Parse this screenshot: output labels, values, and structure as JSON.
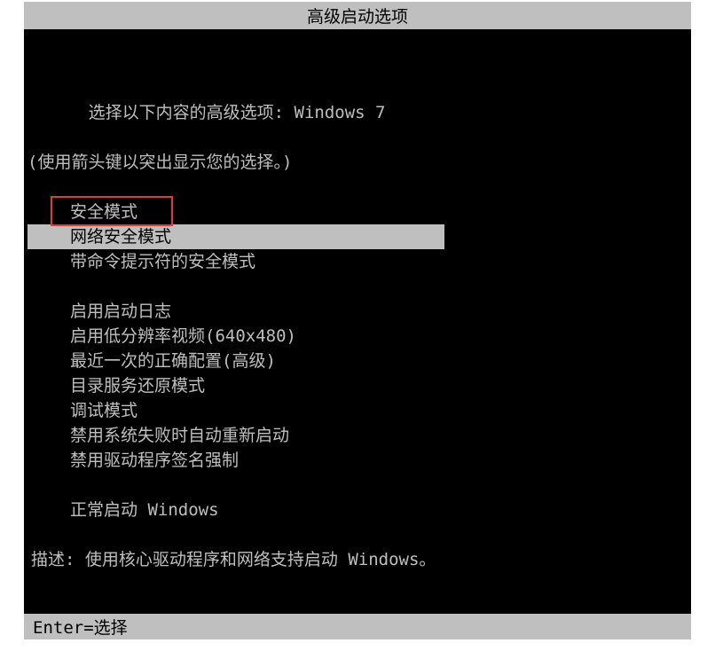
{
  "title": "高级启动选项",
  "intro": {
    "line1_prefix": "选择以下内容的高级选项:",
    "os_name": "Windows 7",
    "line2": "(使用箭头键以突出显示您的选择。)"
  },
  "options": {
    "group1": [
      "安全模式",
      "网络安全模式",
      "带命令提示符的安全模式"
    ],
    "group2": [
      "启用启动日志",
      "启用低分辨率视频(640x480)",
      "最近一次的正确配置(高级)",
      "目录服务还原模式",
      "调试模式",
      "禁用系统失败时自动重新启动",
      "禁用驱动程序签名强制"
    ],
    "group3": [
      "正常启动 Windows"
    ],
    "selected_index": 1,
    "highlighted_index": 0
  },
  "description": {
    "label": "描述:",
    "text": "使用核心驱动程序和网络支持启动 Windows。"
  },
  "footer": {
    "enter_label": "Enter=选择"
  }
}
